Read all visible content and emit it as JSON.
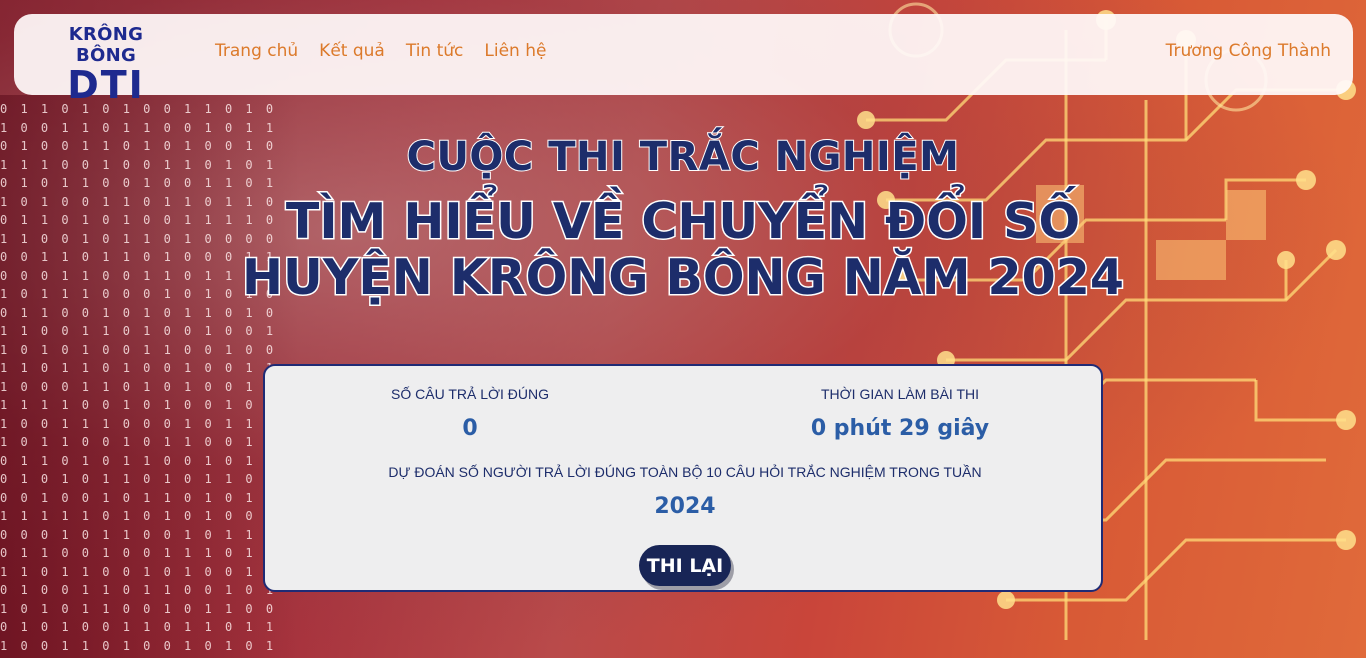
{
  "header": {
    "logo_top": "KRÔNG BÔNG",
    "logo_main": "DTI",
    "nav": [
      "Trang chủ",
      "Kết quả",
      "Tin tức",
      "Liên hệ"
    ],
    "user_name": "Trương Công Thành"
  },
  "titles": {
    "subtitle": "CUỘC THI TRẮC NGHIỆM",
    "line1": "TÌM HIỂU VỀ CHUYỂN ĐỔI SỐ",
    "line2": "HUYỆN KRÔNG BÔNG NĂM 2024"
  },
  "result": {
    "correct_label": "SỐ CÂU TRẢ LỜI ĐÚNG",
    "correct_value": "0",
    "time_label": "THỜI GIAN LÀM BÀI THI",
    "time_value": "0 phút 29 giây",
    "prediction_label": "DỰ ĐOÁN SỐ NGƯỜI TRẢ LỜI ĐÚNG TOÀN BỘ 10 CÂU HỎI TRẮC NGHIỆM TRONG TUẦN",
    "prediction_value": "2024",
    "retry_label": "THI LẠI"
  },
  "colors": {
    "brand_navy": "#1d2d6b",
    "nav_orange": "#dc7a2b",
    "value_blue": "#2b5da6",
    "button_dark": "#182556"
  }
}
